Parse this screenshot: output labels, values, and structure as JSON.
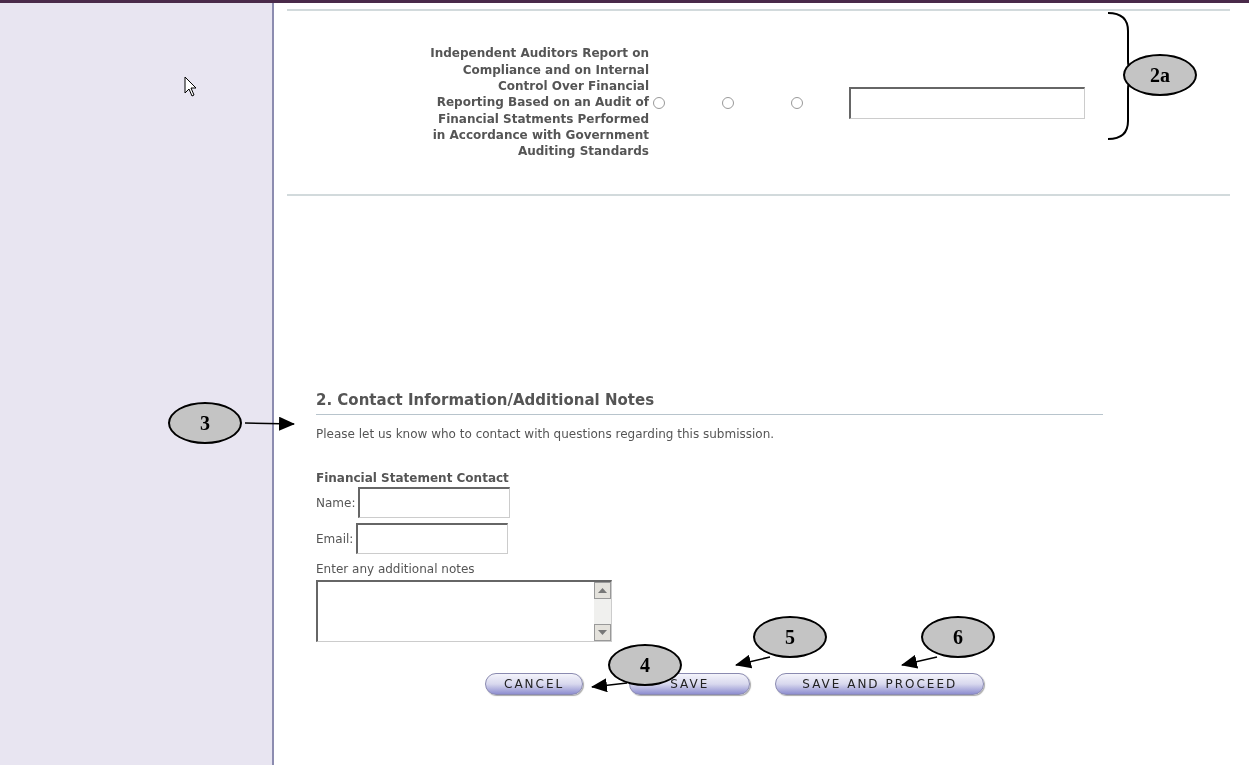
{
  "audit_row": {
    "label": "Independent Auditors Report on Compliance and on Internal Control Over Financial Reporting Based on an Audit of Financial Statments Performed in Accordance with Government Auditing Standards",
    "options": [
      {
        "checked": false
      },
      {
        "checked": false
      },
      {
        "checked": false
      }
    ]
  },
  "contact": {
    "heading": "2. Contact Information/Additional Notes",
    "intro": "Please let us know who to contact with questions regarding this submission.",
    "subheading": "Financial Statement Contact",
    "fields": [
      {
        "label": "Name:"
      },
      {
        "label": "Email:"
      }
    ],
    "notes_label": "Enter any additional notes"
  },
  "buttons": [
    {
      "label": "CANCEL"
    },
    {
      "label": "SAVE"
    },
    {
      "label": "SAVE AND PROCEED"
    }
  ],
  "callouts": [
    {
      "label": "2a",
      "kind": "brace"
    },
    {
      "label": "3",
      "kind": "arrow"
    },
    {
      "label": "4",
      "kind": "arrow"
    },
    {
      "label": "5",
      "kind": "arrow"
    },
    {
      "label": "6",
      "kind": "arrow"
    }
  ]
}
